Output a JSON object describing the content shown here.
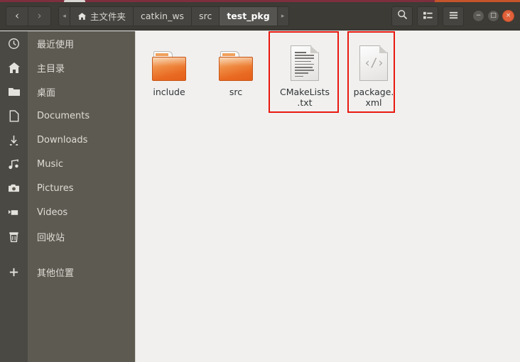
{
  "window": {
    "title": "test_pkg",
    "controls": {
      "minimize": "−",
      "maximize": "□",
      "close": "×",
      "minimize_name": "minimize-button",
      "maximize_name": "maximize-button",
      "close_name": "close-button"
    },
    "accent_color": "#e2613a",
    "toolbar_color": "#3c3b36",
    "sidebar_color": "#5d5b51",
    "content_color": "#f1f0ef",
    "highlight_color": "#e8180f"
  },
  "toolbar": {
    "back_label": "‹",
    "forward_label": "›",
    "back_name": "back-button",
    "forward_name": "forward-button",
    "crumb_prev_label": "◂",
    "crumb_next_label": "▸",
    "search_icon": "search-icon",
    "view_icon": "list-view-icon",
    "menu_icon": "hamburger-menu-icon",
    "breadcrumbs": [
      {
        "label": "主文件夹",
        "icon": "home-icon",
        "active": false
      },
      {
        "label": "catkin_ws",
        "icon": "",
        "active": false
      },
      {
        "label": "src",
        "icon": "",
        "active": false
      },
      {
        "label": "test_pkg",
        "icon": "",
        "active": true
      }
    ]
  },
  "sidebar": {
    "items": [
      {
        "label": "最近使用",
        "icon": "clock-icon"
      },
      {
        "label": "主目录",
        "icon": "home-icon"
      },
      {
        "label": "桌面",
        "icon": "folder-icon"
      },
      {
        "label": "Documents",
        "icon": "document-icon"
      },
      {
        "label": "Downloads",
        "icon": "download-arrow-icon"
      },
      {
        "label": "Music",
        "icon": "music-note-icon"
      },
      {
        "label": "Pictures",
        "icon": "camera-icon"
      },
      {
        "label": "Videos",
        "icon": "video-camera-icon"
      },
      {
        "label": "回收站",
        "icon": "trash-icon"
      },
      {
        "label": "其他位置",
        "icon": "plus-icon"
      }
    ]
  },
  "files": [
    {
      "name": "include",
      "type": "folder",
      "highlighted": false
    },
    {
      "name": "src",
      "type": "folder",
      "highlighted": false
    },
    {
      "name": "CMakeLists\n.txt",
      "name_line1": "CMakeLists",
      "name_line2": ".txt",
      "type": "text-document",
      "highlighted": true
    },
    {
      "name": "package.\nxml",
      "name_line1": "package.",
      "name_line2": "xml",
      "type": "xml-document",
      "xml_glyph": "‹/›",
      "highlighted": true
    }
  ]
}
